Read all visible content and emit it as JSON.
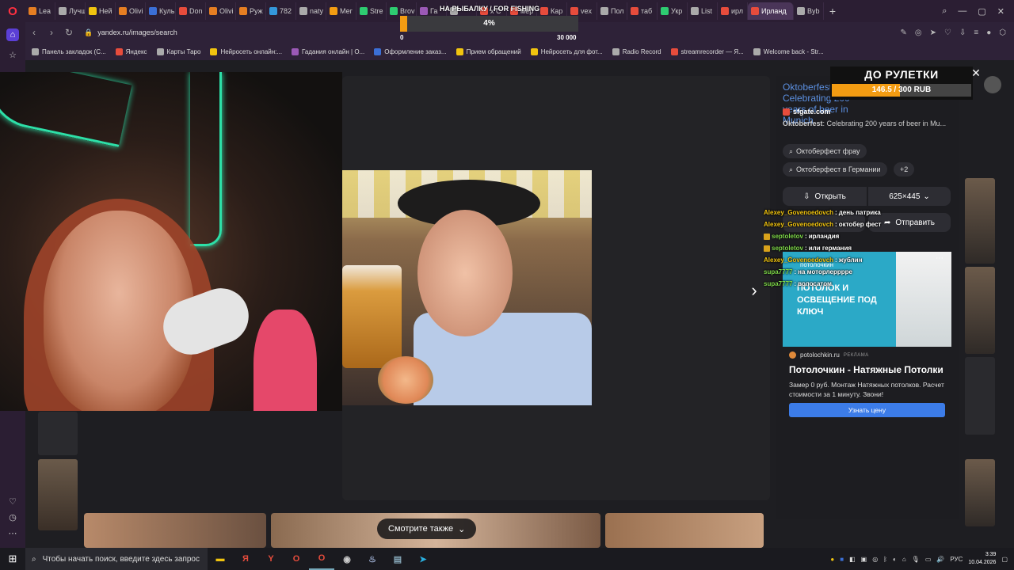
{
  "tabs": [
    {
      "label": "Lea",
      "color": "#e67e22"
    },
    {
      "label": "Лучш",
      "color": "#aaaaaa"
    },
    {
      "label": "Heй",
      "color": "#f1c40f"
    },
    {
      "label": "Olivi",
      "color": "#e67e22"
    },
    {
      "label": "Куль",
      "color": "#3b6fd6"
    },
    {
      "label": "Don",
      "color": "#e74c3c"
    },
    {
      "label": "Olivi",
      "color": "#e67e22"
    },
    {
      "label": "Руж",
      "color": "#e67e22"
    },
    {
      "label": "782",
      "color": "#3498db"
    },
    {
      "label": "naty",
      "color": "#aaaaaa"
    },
    {
      "label": "Мег",
      "color": "#f39c12"
    },
    {
      "label": "Stre",
      "color": "#2ecc71"
    },
    {
      "label": "Brov",
      "color": "#2ecc71"
    },
    {
      "label": "Га",
      "color": "#9b59b6"
    },
    {
      "label": "",
      "color": "#aaaaaa"
    },
    {
      "label": "x С",
      "color": "#e74c3c"
    },
    {
      "label": "мер",
      "color": "#e74c3c"
    },
    {
      "label": "Кар",
      "color": "#e74c3c"
    },
    {
      "label": "vex",
      "color": "#e74c3c"
    },
    {
      "label": "Пол",
      "color": "#aaaaaa"
    },
    {
      "label": "таб",
      "color": "#e74c3c"
    },
    {
      "label": "Укр",
      "color": "#2ecc71"
    },
    {
      "label": "List",
      "color": "#aaaaaa"
    },
    {
      "label": "ирл",
      "color": "#e74c3c"
    },
    {
      "label": "Ирланд",
      "color": "#e74c3c",
      "active": true
    },
    {
      "label": "Byb",
      "color": "#aaaaaa"
    }
  ],
  "address": {
    "url": "yandex.ru/images/search"
  },
  "bookmarks": [
    {
      "label": "Панель закладок (С...",
      "color": "#aaaaaa"
    },
    {
      "label": "Яндекс",
      "color": "#e74c3c"
    },
    {
      "label": "Карты Таро",
      "color": "#aaaaaa"
    },
    {
      "label": "Нейросеть онлайн:...",
      "color": "#f1c40f"
    },
    {
      "label": "Гадания онлайн | О...",
      "color": "#9b59b6"
    },
    {
      "label": "Оформление заказ...",
      "color": "#3b6fd6"
    },
    {
      "label": "Прием обращений",
      "color": "#f1c40f"
    },
    {
      "label": "Нейросеть для фот...",
      "color": "#f1c40f"
    },
    {
      "label": "Radio Record",
      "color": "#aaaaaa"
    },
    {
      "label": "streamrecorder — Я...",
      "color": "#e74c3c"
    },
    {
      "label": "Welcome back - Str...",
      "color": "#aaaaaa"
    }
  ],
  "overlay_fishing": {
    "title": "НА РЫБАЛКУ / FOR FISHING",
    "percent_text": "4%",
    "percent": 4,
    "min": "0",
    "max": "30 000"
  },
  "overlay_roulette": {
    "title": "ДО РУЛЕТКИ",
    "value_text": "146.5 / 300 RUB",
    "current": 146.5,
    "goal": 300
  },
  "result": {
    "title": "Oktoberfest: Celebrating 200 years of beer in Munich",
    "site": "sfgate.com",
    "description_bold": "Oktoberfest",
    "description": ": Celebrating 200 years of beer in Mu...",
    "chips": [
      "Октоберфест фрау",
      "Октоберфест в Германии",
      "+2"
    ],
    "open_label": "Открыть",
    "size_label": "625×445",
    "send_label": "Отправить"
  },
  "chat": [
    {
      "user": "Alexey_Govenoedovch",
      "user_color": "#f1c40f",
      "badge": false,
      "message": "день патрика"
    },
    {
      "user": "Alexey_Govenoedovch",
      "user_color": "#f1c40f",
      "badge": false,
      "message": "октобер фест"
    },
    {
      "user": "septoletov",
      "user_color": "#7fd94a",
      "badge": true,
      "message": "ирландия"
    },
    {
      "user": "septoletov",
      "user_color": "#7fd94a",
      "badge": true,
      "message": "или германия"
    },
    {
      "user": "Alexey_Govenoedovch",
      "user_color": "#f1c40f",
      "badge": false,
      "message": "жублин"
    },
    {
      "user": "supa7777",
      "user_color": "#7fd94a",
      "badge": false,
      "message": "на моторлерррре"
    },
    {
      "user": "supa7777",
      "user_color": "#7fd94a",
      "badge": false,
      "message": "волосатом"
    }
  ],
  "ad": {
    "headline": "ПОТОЛОК И ОСВЕЩЕНИЕ ПОД КЛЮЧ",
    "brand": "потолочкин",
    "site": "potolochkin.ru",
    "label": "РЕКЛАМА",
    "title": "Потолочкин - Натяжные Потолки",
    "text": "Замер 0 руб. Монтаж Натяжных потолков. Расчет стоимости за 1 минуту. Звони!",
    "button": "Узнать цену"
  },
  "see_also": "Смотрите также",
  "taskbar": {
    "search_placeholder": "Чтобы начать поиск, введите здесь запрос",
    "lang": "РУС",
    "time": "3:39",
    "date": "10.04.2026"
  }
}
